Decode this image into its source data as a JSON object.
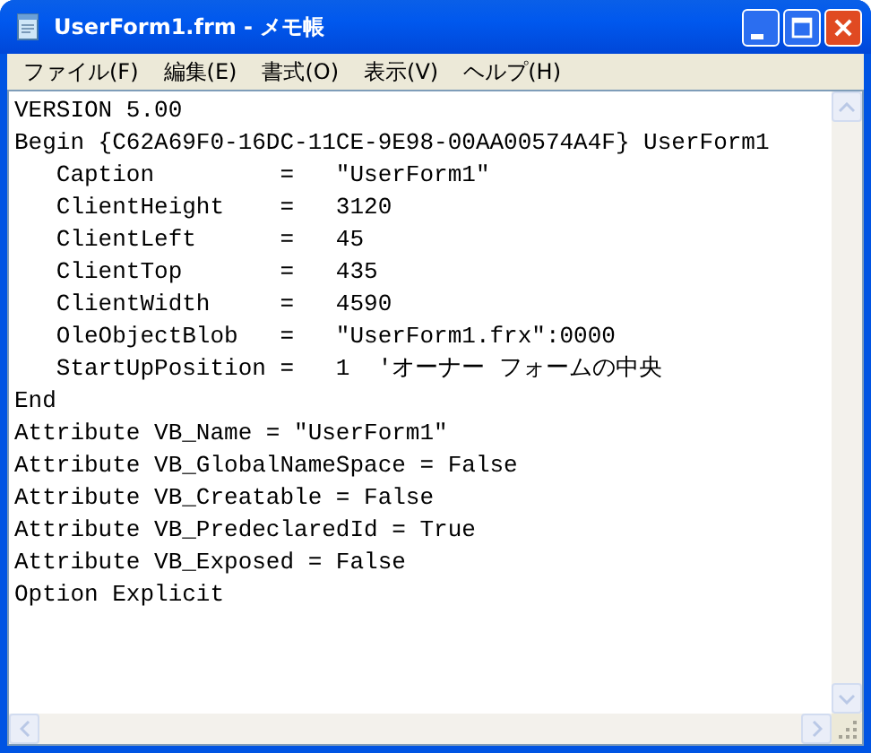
{
  "window": {
    "title": "UserForm1.frm - メモ帳"
  },
  "menu": [
    {
      "label": "ファイル(F)"
    },
    {
      "label": "編集(E)"
    },
    {
      "label": "書式(O)"
    },
    {
      "label": "表示(V)"
    },
    {
      "label": "ヘルプ(H)"
    }
  ],
  "lines": [
    "VERSION 5.00",
    "Begin {C62A69F0-16DC-11CE-9E98-00AA00574A4F} UserForm1",
    "   Caption         =   \"UserForm1\"",
    "   ClientHeight    =   3120",
    "   ClientLeft      =   45",
    "   ClientTop       =   435",
    "   ClientWidth     =   4590",
    "   OleObjectBlob   =   \"UserForm1.frx\":0000",
    "   StartUpPosition =   1  'オーナー フォームの中央",
    "End",
    "Attribute VB_Name = \"UserForm1\"",
    "Attribute VB_GlobalNameSpace = False",
    "Attribute VB_Creatable = False",
    "Attribute VB_PredeclaredId = True",
    "Attribute VB_Exposed = False",
    "Option Explicit"
  ]
}
